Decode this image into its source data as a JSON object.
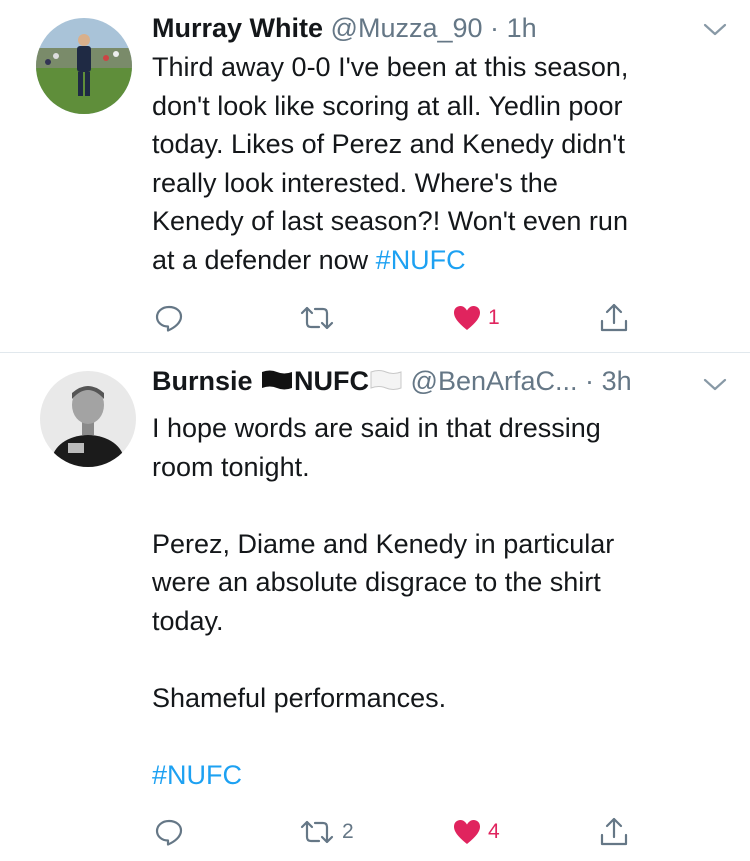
{
  "tweets": [
    {
      "name": "Murray White",
      "handle": "@Muzza_90",
      "separator": "·",
      "time": "1h",
      "body_lines": [
        "Third away 0-0 I've been at this season,",
        "don't look like scoring at all. Yedlin poor",
        "today. Likes of Perez and Kenedy didn't",
        "really look interested. Where's the",
        "Kenedy of last season?! Won't even run"
      ],
      "last_line_text": "at a defender now ",
      "hashtag": "#NUFC",
      "replies": "",
      "retweets": "",
      "likes": "1"
    },
    {
      "name_prefix": "Burnsie ",
      "name_suffix": "NUFC",
      "handle": "@BenArfaC...",
      "separator": "·",
      "time": "3h",
      "paragraph1": [
        "I hope words are said in that dressing",
        "room tonight."
      ],
      "paragraph2": [
        "Perez, Diame and Kenedy in particular",
        "were an absolute disgrace to the shirt",
        "today."
      ],
      "paragraph3": "Shameful performances.",
      "hashtag": "#NUFC",
      "replies": "",
      "retweets": "2",
      "likes": "4"
    }
  ],
  "colors": {
    "text": "#14171a",
    "secondary": "#657786",
    "link": "#1da1f2",
    "like": "#e0245e",
    "divider": "#e1e8ed"
  },
  "icons": [
    "reply-icon",
    "retweet-icon",
    "heart-icon",
    "share-icon",
    "chevron-down-icon",
    "black-flag-icon",
    "white-flag-icon"
  ]
}
